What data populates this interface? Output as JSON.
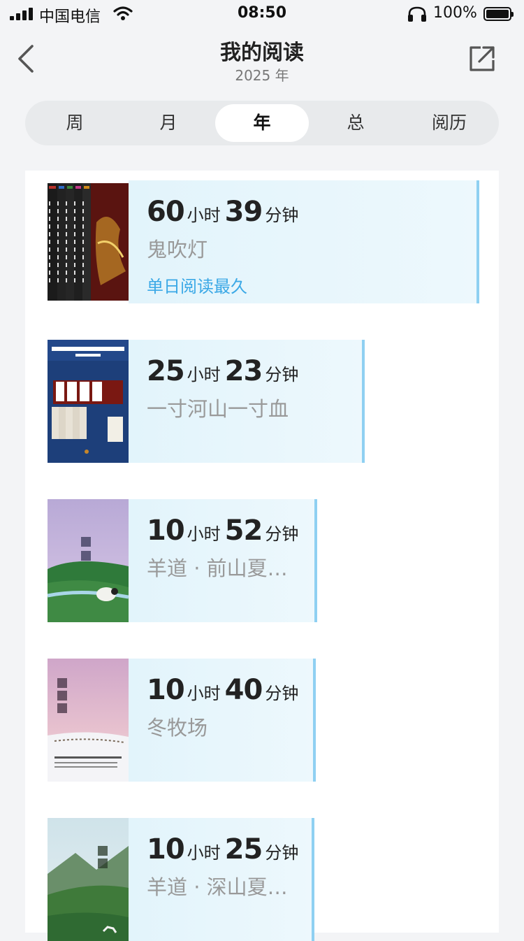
{
  "status_bar": {
    "carrier": "中国电信",
    "time": "08:50",
    "battery": "100%"
  },
  "nav": {
    "title": "我的阅读",
    "subtitle": "2025 年",
    "back_icon": "chevron-left-icon",
    "share_icon": "share-icon"
  },
  "tabs": [
    {
      "label": "周",
      "active": false
    },
    {
      "label": "月",
      "active": false
    },
    {
      "label": "年",
      "active": true
    },
    {
      "label": "总",
      "active": false
    },
    {
      "label": "阅历",
      "active": false
    }
  ],
  "colors": {
    "accent": "#3aa8e6",
    "bar_border": "#8fd0f2",
    "bar_fill": "#e2f4fb",
    "tab_bg": "#e8eaec"
  },
  "books": [
    {
      "hours": "60",
      "hours_unit": "小时",
      "minutes": "39",
      "minutes_unit": "分钟",
      "title": "鬼吹灯",
      "tag": "单日阅读最久",
      "duration_share": 1.0
    },
    {
      "hours": "25",
      "hours_unit": "小时",
      "minutes": "23",
      "minutes_unit": "分钟",
      "title": "一寸河山一寸血",
      "tag": "",
      "duration_share": 0.42
    },
    {
      "hours": "10",
      "hours_unit": "小时",
      "minutes": "52",
      "minutes_unit": "分钟",
      "title": "羊道 · 前山夏…",
      "tag": "",
      "duration_share": 0.18
    },
    {
      "hours": "10",
      "hours_unit": "小时",
      "minutes": "40",
      "minutes_unit": "分钟",
      "title": "冬牧场",
      "tag": "",
      "duration_share": 0.18
    },
    {
      "hours": "10",
      "hours_unit": "小时",
      "minutes": "25",
      "minutes_unit": "分钟",
      "title": "羊道 · 深山夏…",
      "tag": "",
      "duration_share": 0.17
    }
  ]
}
